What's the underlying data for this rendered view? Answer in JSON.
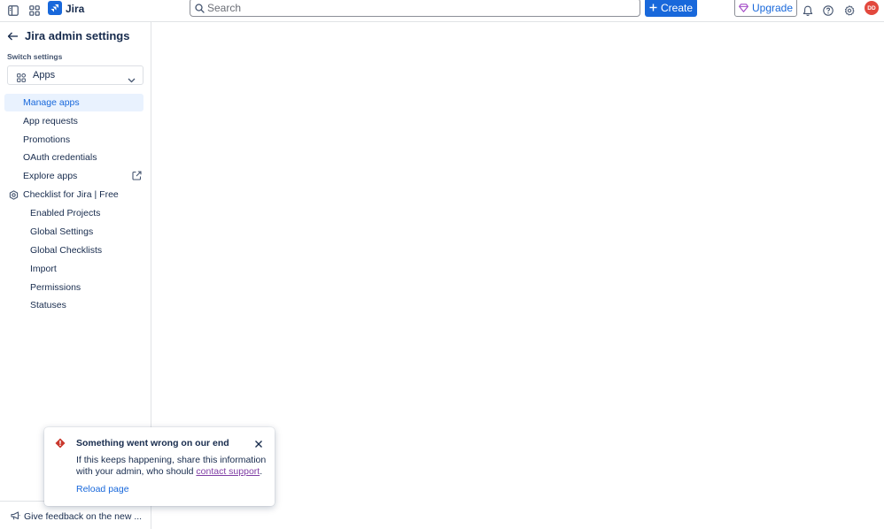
{
  "topbar": {
    "app_name": "Jira",
    "search_placeholder": "Search",
    "create_label": "Create",
    "upgrade_label": "Upgrade",
    "avatar_initials": "DD"
  },
  "sidebar": {
    "title": "Jira admin settings",
    "switch_label": "Switch settings",
    "switch_value": "Apps",
    "items": [
      {
        "label": "Manage apps",
        "active": true
      },
      {
        "label": "App requests"
      },
      {
        "label": "Promotions"
      },
      {
        "label": "OAuth credentials"
      },
      {
        "label": "Explore apps"
      },
      {
        "label": "Checklist for Jira | Free"
      }
    ],
    "sub_items": [
      {
        "label": "Enabled Projects"
      },
      {
        "label": "Global Settings"
      },
      {
        "label": "Global Checklists"
      },
      {
        "label": "Import"
      },
      {
        "label": "Permissions"
      },
      {
        "label": "Statuses"
      }
    ],
    "feedback_label": "Give feedback on the new ..."
  },
  "error_flag": {
    "title": "Something went wrong on our end",
    "body_prefix": "If this keeps happening, share this information with your admin, who should ",
    "link_text": "contact support",
    "body_suffix": ".",
    "reload_label": "Reload page"
  },
  "colors": {
    "brand": "#1868db",
    "active_bg": "#e9f2fe",
    "error": "#c9372c",
    "avatar": "#e2483d",
    "link_visited": "#803fa5"
  }
}
